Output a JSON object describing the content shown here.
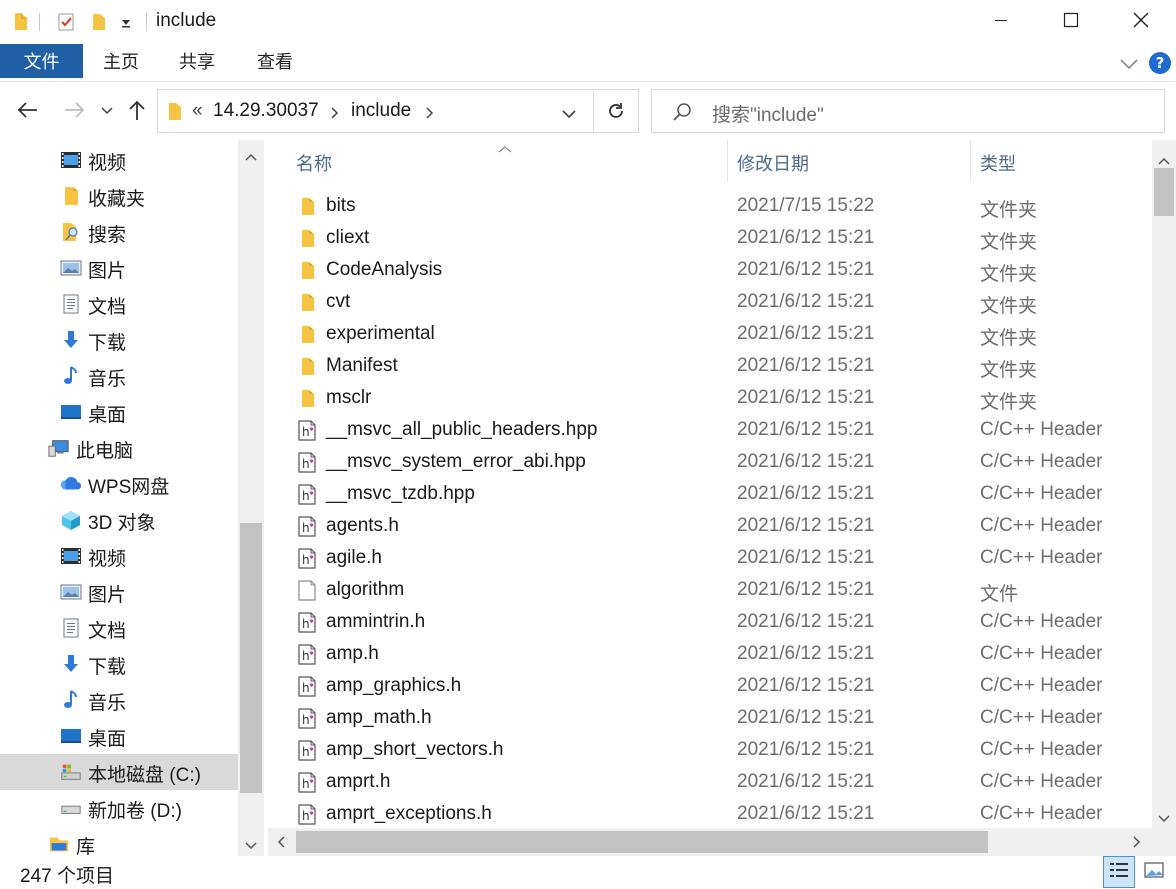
{
  "window": {
    "title": "include",
    "minimize_icon": "minimize-icon",
    "maximize_icon": "maximize-icon",
    "close_icon": "close-icon"
  },
  "ribbon": {
    "tabs": [
      "文件",
      "主页",
      "共享",
      "查看"
    ]
  },
  "address": {
    "overflow": "«",
    "crumbs": [
      "14.29.30037",
      "include"
    ],
    "search_placeholder": "搜索\"include\""
  },
  "nav": [
    {
      "label": "视频",
      "icon": "video-folder-icon"
    },
    {
      "label": "收藏夹",
      "icon": "favorites-folder-icon"
    },
    {
      "label": "搜索",
      "icon": "search-folder-icon"
    },
    {
      "label": "图片",
      "icon": "pictures-folder-icon"
    },
    {
      "label": "文档",
      "icon": "documents-folder-icon"
    },
    {
      "label": "下载",
      "icon": "downloads-folder-icon"
    },
    {
      "label": "音乐",
      "icon": "music-folder-icon"
    },
    {
      "label": "桌面",
      "icon": "desktop-folder-icon"
    },
    {
      "label": "此电脑",
      "icon": "this-pc-icon"
    },
    {
      "label": "WPS网盘",
      "icon": "wps-cloud-icon"
    },
    {
      "label": "3D 对象",
      "icon": "3d-objects-icon"
    },
    {
      "label": "视频",
      "icon": "video-folder-icon"
    },
    {
      "label": "图片",
      "icon": "pictures-folder-icon"
    },
    {
      "label": "文档",
      "icon": "documents-folder-icon"
    },
    {
      "label": "下载",
      "icon": "downloads-folder-icon"
    },
    {
      "label": "音乐",
      "icon": "music-folder-icon"
    },
    {
      "label": "桌面",
      "icon": "desktop-folder-icon"
    },
    {
      "label": "本地磁盘 (C:)",
      "icon": "local-disk-icon",
      "selected": true
    },
    {
      "label": "新加卷 (D:)",
      "icon": "drive-icon"
    },
    {
      "label": "库",
      "icon": "library-icon"
    }
  ],
  "columns": {
    "name": "名称",
    "date": "修改日期",
    "type": "类型"
  },
  "files": [
    {
      "name": "bits",
      "date": "2021/7/15 15:22",
      "type": "文件夹",
      "kind": "folder"
    },
    {
      "name": "cliext",
      "date": "2021/6/12 15:21",
      "type": "文件夹",
      "kind": "folder"
    },
    {
      "name": "CodeAnalysis",
      "date": "2021/6/12 15:21",
      "type": "文件夹",
      "kind": "folder"
    },
    {
      "name": "cvt",
      "date": "2021/6/12 15:21",
      "type": "文件夹",
      "kind": "folder"
    },
    {
      "name": "experimental",
      "date": "2021/6/12 15:21",
      "type": "文件夹",
      "kind": "folder"
    },
    {
      "name": "Manifest",
      "date": "2021/6/12 15:21",
      "type": "文件夹",
      "kind": "folder"
    },
    {
      "name": "msclr",
      "date": "2021/6/12 15:21",
      "type": "文件夹",
      "kind": "folder"
    },
    {
      "name": "__msvc_all_public_headers.hpp",
      "date": "2021/6/12 15:21",
      "type": "C/C++ Header",
      "kind": "header"
    },
    {
      "name": "__msvc_system_error_abi.hpp",
      "date": "2021/6/12 15:21",
      "type": "C/C++ Header",
      "kind": "header"
    },
    {
      "name": "__msvc_tzdb.hpp",
      "date": "2021/6/12 15:21",
      "type": "C/C++ Header",
      "kind": "header"
    },
    {
      "name": "agents.h",
      "date": "2021/6/12 15:21",
      "type": "C/C++ Header",
      "kind": "header"
    },
    {
      "name": "agile.h",
      "date": "2021/6/12 15:21",
      "type": "C/C++ Header",
      "kind": "header"
    },
    {
      "name": "algorithm",
      "date": "2021/6/12 15:21",
      "type": "文件",
      "kind": "file"
    },
    {
      "name": "ammintrin.h",
      "date": "2021/6/12 15:21",
      "type": "C/C++ Header",
      "kind": "header"
    },
    {
      "name": "amp.h",
      "date": "2021/6/12 15:21",
      "type": "C/C++ Header",
      "kind": "header"
    },
    {
      "name": "amp_graphics.h",
      "date": "2021/6/12 15:21",
      "type": "C/C++ Header",
      "kind": "header"
    },
    {
      "name": "amp_math.h",
      "date": "2021/6/12 15:21",
      "type": "C/C++ Header",
      "kind": "header"
    },
    {
      "name": "amp_short_vectors.h",
      "date": "2021/6/12 15:21",
      "type": "C/C++ Header",
      "kind": "header"
    },
    {
      "name": "amprt.h",
      "date": "2021/6/12 15:21",
      "type": "C/C++ Header",
      "kind": "header"
    },
    {
      "name": "amprt_exceptions.h",
      "date": "2021/6/12 15:21",
      "type": "C/C++ Header",
      "kind": "header"
    }
  ],
  "status": {
    "count": "247 个项目"
  },
  "colors": {
    "accent": "#1f5fa6",
    "folder": "#f6c342",
    "selection": "#d9d9d9",
    "header_text": "#4d6a8a"
  }
}
